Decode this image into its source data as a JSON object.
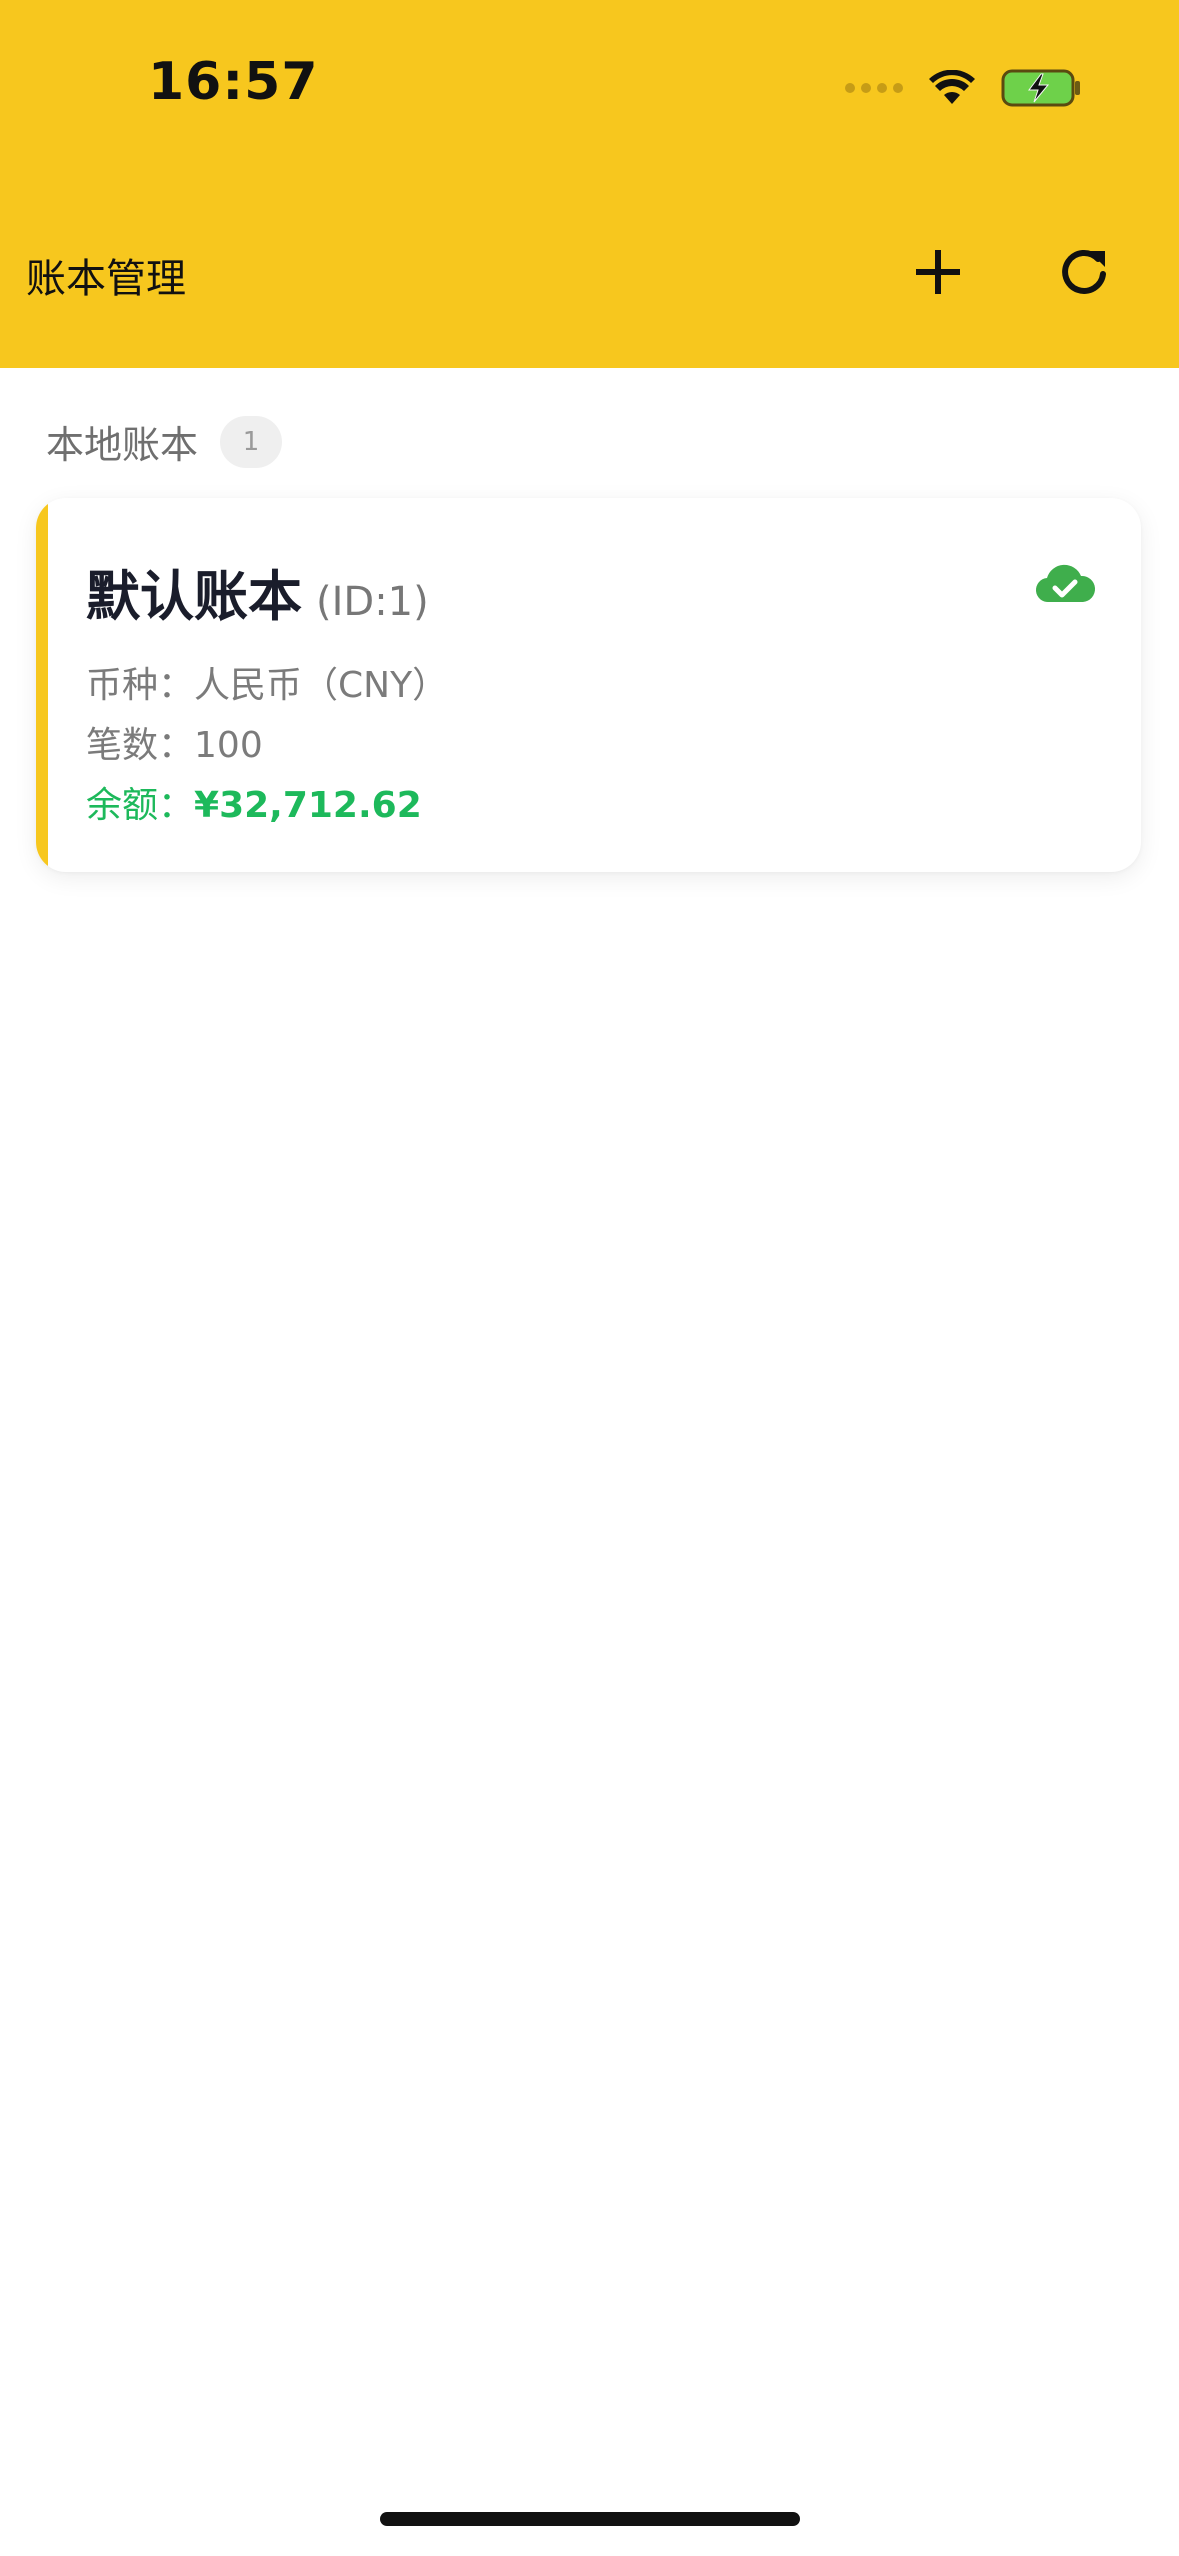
{
  "status_bar": {
    "time": "16:57"
  },
  "header": {
    "title": "账本管理",
    "add_icon": "plus-icon",
    "refresh_icon": "refresh-icon",
    "background_color": "#F7C71E"
  },
  "section": {
    "title": "本地账本",
    "count": "1"
  },
  "ledgers": [
    {
      "name": "默认账本",
      "id_text": "(ID:1)",
      "currency_label": "币种：",
      "currency_value": "人民币（CNY）",
      "count_label": "笔数：",
      "count_value": "100",
      "balance_label": "余额：",
      "balance_value": "¥32,712.62",
      "sync_icon": "cloud-check-icon",
      "sync_color": "#3fae4c",
      "accent_color": "#F7C71E",
      "balance_color": "#1db95b"
    }
  ]
}
